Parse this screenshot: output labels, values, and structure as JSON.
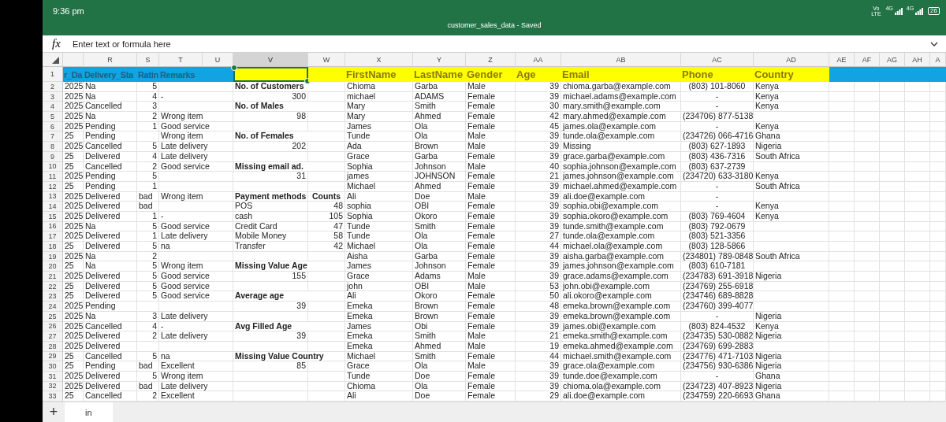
{
  "status_bar": {
    "time": "9:36 pm",
    "carrier": "Vo LTE",
    "networks": [
      "4G",
      "4G"
    ],
    "battery": "26"
  },
  "title_bar": {
    "title": "customer_sales_data - Saved"
  },
  "formula_bar": {
    "label": "fx",
    "placeholder": "Enter text or formula here"
  },
  "sheet": {
    "columns": [
      {
        "selected": false
      },
      {
        "letter": "R",
        "selected": false
      },
      {
        "letter": "S",
        "selected": false
      },
      {
        "letter": "T",
        "selected": false
      },
      {
        "letter": "U",
        "selected": false
      },
      {
        "letter": "V",
        "selected": true
      },
      {
        "letter": "W",
        "selected": false
      },
      {
        "letter": "X",
        "selected": false
      },
      {
        "letter": "Y",
        "selected": false
      },
      {
        "letter": "Z",
        "selected": false
      },
      {
        "letter": "AA",
        "selected": false
      },
      {
        "letter": "AB",
        "selected": false
      },
      {
        "letter": "AC",
        "selected": false
      },
      {
        "letter": "AD",
        "selected": false
      },
      {
        "letter": "AE",
        "selected": false
      },
      {
        "letter": "AF",
        "selected": false
      },
      {
        "letter": "AG",
        "selected": false
      },
      {
        "letter": "AH",
        "selected": false
      },
      {
        "letter": "A",
        "selected": false
      }
    ],
    "header_row": {
      "number": "1",
      "cells": [
        {
          "text": "r_Da",
          "color": "#12a3e3",
          "selected": false
        },
        {
          "text": "Delivery_Sta",
          "color": "#12a3e3",
          "selected": false
        },
        {
          "text": "Ratin",
          "color": "#12a3e3",
          "selected": false
        },
        {
          "text": "Remarks",
          "color": "#12a3e3",
          "selected": false
        },
        {
          "color": "#12a3e3",
          "selected": false
        },
        {
          "color": "#ffff00",
          "selected": true
        },
        {
          "color": "#ffff00",
          "selected": false
        },
        {
          "text": "FirstName",
          "color": "#ffff00",
          "selected": false
        },
        {
          "text": "LastName",
          "color": "#ffff00",
          "selected": false
        },
        {
          "text": "Gender",
          "color": "#ffff00",
          "selected": false
        },
        {
          "text": "Age",
          "color": "#ffff00",
          "selected": false
        },
        {
          "text": "Email",
          "color": "#ffff00",
          "selected": false
        },
        {
          "text": "Phone",
          "color": "#ffff00",
          "selected": false
        },
        {
          "text": "Country",
          "color": "#ffff00",
          "selected": false
        },
        {
          "color": "#12a3e3",
          "selected": false
        },
        {
          "color": "#12a3e3",
          "selected": false
        },
        {
          "color": "#12a3e3",
          "selected": false
        },
        {
          "color": "#12a3e3",
          "selected": false
        },
        {
          "color": "#12a3e3",
          "selected": false
        }
      ]
    },
    "rows": [
      {
        "number": "2",
        "year": "2025",
        "status": "Na",
        "rating": "5",
        "summary": {
          "kind": "heading",
          "text": "No. of Customers"
        },
        "first": "Chioma",
        "last": "Garba",
        "gender": "Male",
        "age": "39",
        "email": "chioma.garba@example.com",
        "phone": "(803) 101-8060",
        "country": "Kenya"
      },
      {
        "number": "3",
        "year": "2025",
        "status": "Na",
        "rating": "4",
        "remarks": "-",
        "summary": {
          "kind": "number",
          "text": "300"
        },
        "first": "michael",
        "last": "ADAMS",
        "gender": "Female",
        "age": "39",
        "email": "michael.adams@example.com",
        "phone": "-",
        "country": "Kenya"
      },
      {
        "number": "4",
        "year": "2025",
        "status": "Cancelled",
        "rating": "3",
        "summary": {
          "kind": "heading",
          "text": "No. of Males"
        },
        "first": "Mary",
        "last": "Smith",
        "gender": "Female",
        "age": "30",
        "email": "mary.smith@example.com",
        "phone": "-",
        "country": "Kenya"
      },
      {
        "number": "5",
        "year": "2025",
        "status": "Na",
        "rating": "2",
        "remarks": "Wrong item",
        "summary": {
          "kind": "number",
          "text": "98"
        },
        "first": "Mary",
        "last": "Ahmed",
        "gender": "Female",
        "age": "42",
        "email": "mary.ahmed@example.com",
        "phone": "(234706) 877-5138"
      },
      {
        "number": "6",
        "year": "2025",
        "status": "Pending",
        "rating": "1",
        "remarks": "Good service",
        "first": "James",
        "last": "Ola",
        "gender": "Female",
        "age": "45",
        "email": "james.ola@example.com",
        "phone": "-",
        "country": "Kenya"
      },
      {
        "number": "7",
        "year": "25",
        "status": "Pending",
        "remarks": "Wrong item",
        "summary": {
          "kind": "heading",
          "text": "No. of Females"
        },
        "first": "Tunde",
        "last": "Ola",
        "gender": "Male",
        "age": "39",
        "email": "tunde.ola@example.com",
        "phone": "(234726) 066-4716",
        "country": "Ghana"
      },
      {
        "number": "8",
        "year": "2025",
        "status": "Cancelled",
        "rating": "5",
        "remarks": "Late delivery",
        "summary": {
          "kind": "number",
          "text": "202"
        },
        "first": "Ada",
        "last": "Brown",
        "gender": "Male",
        "age": "39",
        "email": "Missing",
        "phone": "(803) 627-1893",
        "country": "Nigeria"
      },
      {
        "number": "9",
        "year": "25",
        "status": "Delivered",
        "rating": "4",
        "remarks": "Late delivery",
        "first": "Grace",
        "last": "Garba",
        "gender": "Female",
        "age": "39",
        "email": "grace.garba@example.com",
        "phone": "(803) 436-7316",
        "country": "South Africa"
      },
      {
        "number": "10",
        "year": "25",
        "status": "Cancelled",
        "rating": "2",
        "remarks": "Good service",
        "summary": {
          "kind": "heading",
          "text": "Missing email ad."
        },
        "first": "Sophia",
        "last": "Johnson",
        "gender": "Male",
        "age": "40",
        "email": "sophia.johnson@example.com",
        "phone": "(803) 637-2739"
      },
      {
        "number": "11",
        "year": "2025",
        "status": "Pending",
        "rating": "5",
        "summary": {
          "kind": "number",
          "text": "31"
        },
        "first": "james",
        "last": "JOHNSON",
        "gender": "Female",
        "age": "21",
        "email": "james.johnson@example.com",
        "phone": "(234720) 633-3180",
        "country": "Kenya"
      },
      {
        "number": "12",
        "year": "25",
        "status": "Pending",
        "rating": "1",
        "first": "Michael",
        "last": "Ahmed",
        "gender": "Female",
        "age": "39",
        "email": "michael.ahmed@example.com",
        "phone": "-",
        "country": "South Africa"
      },
      {
        "number": "13",
        "year": "2025",
        "status": "Delivered",
        "rating": "bad",
        "remarks": "Wrong item",
        "summary": {
          "kind": "heading",
          "text": "Payment methods"
        },
        "count": {
          "kind": "heading",
          "text": "Counts"
        },
        "first": "Ali",
        "last": "Doe",
        "gender": "Male",
        "age": "39",
        "email": "ali.doe@example.com",
        "phone": "-"
      },
      {
        "number": "14",
        "year": "2025",
        "status": "Delivered",
        "rating": "bad",
        "summary": {
          "kind": "item",
          "text": "POS"
        },
        "count": {
          "kind": "number",
          "text": "48"
        },
        "first": "sophia",
        "last": "OBI",
        "gender": "Female",
        "age": "39",
        "email": "sophia.obi@example.com",
        "phone": "-",
        "country": "Kenya"
      },
      {
        "number": "15",
        "year": "2025",
        "status": "Delivered",
        "rating": "1",
        "remarks": "-",
        "summary": {
          "kind": "item",
          "text": "cash"
        },
        "count": {
          "kind": "number",
          "text": "105"
        },
        "first": "Sophia",
        "last": "Okoro",
        "gender": "Female",
        "age": "39",
        "email": "sophia.okoro@example.com",
        "phone": "(803) 769-4604",
        "country": "Kenya"
      },
      {
        "number": "16",
        "year": "2025",
        "status": "Na",
        "rating": "5",
        "remarks": "Good service",
        "summary": {
          "kind": "item",
          "text": "Credit Card"
        },
        "count": {
          "kind": "number",
          "text": "47"
        },
        "first": "Tunde",
        "last": "Smith",
        "gender": "Female",
        "age": "39",
        "email": "tunde.smith@example.com",
        "phone": "(803) 792-0679"
      },
      {
        "number": "17",
        "year": "2025",
        "status": "Delivered",
        "rating": "1",
        "remarks": "Late delivery",
        "summary": {
          "kind": "item",
          "text": "Mobile Money"
        },
        "count": {
          "kind": "number",
          "text": "58"
        },
        "first": "Tunde",
        "last": "Ola",
        "gender": "Female",
        "age": "27",
        "email": "tunde.ola@example.com",
        "phone": "(803) 521-3356"
      },
      {
        "number": "18",
        "year": "25",
        "status": "Delivered",
        "rating": "5",
        "remarks": "na",
        "summary": {
          "kind": "item",
          "text": "Transfer"
        },
        "count": {
          "kind": "number",
          "text": "42"
        },
        "first": "Michael",
        "last": "Ola",
        "gender": "Female",
        "age": "44",
        "email": "michael.ola@example.com",
        "phone": "(803) 128-5866"
      },
      {
        "number": "19",
        "year": "2025",
        "status": "Na",
        "rating": "2",
        "first": "Aisha",
        "last": "Garba",
        "gender": "Female",
        "age": "39",
        "email": "aisha.garba@example.com",
        "phone": "(234801) 789-0848",
        "country": "South Africa"
      },
      {
        "number": "20",
        "year": "25",
        "status": "Na",
        "rating": "5",
        "remarks": "Wrong item",
        "summary": {
          "kind": "heading",
          "text": "Missing Value Age"
        },
        "first": "James",
        "last": "Johnson",
        "gender": "Female",
        "age": "39",
        "email": "james.johnson@example.com",
        "phone": "(803) 610-7181"
      },
      {
        "number": "21",
        "year": "2025",
        "status": "Delivered",
        "rating": "5",
        "remarks": "Good service",
        "summary": {
          "kind": "number",
          "text": "155"
        },
        "first": "Grace",
        "last": "Adams",
        "gender": "Male",
        "age": "39",
        "email": "grace.adams@example.com",
        "phone": "(234783) 691-3918",
        "country": "Nigeria"
      },
      {
        "number": "22",
        "year": "25",
        "status": "Delivered",
        "rating": "5",
        "remarks": "Good service",
        "first": "john",
        "last": "OBI",
        "gender": "Male",
        "age": "53",
        "email": "john.obi@example.com",
        "phone": "(234769) 255-6918"
      },
      {
        "number": "23",
        "year": "25",
        "status": "Delivered",
        "rating": "5",
        "remarks": "Good service",
        "summary": {
          "kind": "heading",
          "text": "Average age"
        },
        "first": "Ali",
        "last": "Okoro",
        "gender": "Female",
        "age": "50",
        "email": "ali.okoro@example.com",
        "phone": "(234746) 689-8828"
      },
      {
        "number": "24",
        "year": "2025",
        "status": "Pending",
        "summary": {
          "kind": "number",
          "text": "39"
        },
        "first": "Emeka",
        "last": "Brown",
        "gender": "Female",
        "age": "48",
        "email": "emeka.brown@example.com",
        "phone": "(234760) 399-4077"
      },
      {
        "number": "25",
        "year": "2025",
        "status": "Na",
        "rating": "3",
        "remarks": "Late delivery",
        "first": "Emeka",
        "last": "Brown",
        "gender": "Female",
        "age": "39",
        "email": "emeka.brown@example.com",
        "phone": "-",
        "country": "Nigeria"
      },
      {
        "number": "26",
        "year": "2025",
        "status": "Cancelled",
        "rating": "4",
        "remarks": "-",
        "summary": {
          "kind": "heading",
          "text": "Avg Filled Age"
        },
        "first": "James",
        "last": "Obi",
        "gender": "Female",
        "age": "39",
        "email": "james.obi@example.com",
        "phone": "(803) 824-4532",
        "country": "Kenya"
      },
      {
        "number": "27",
        "year": "2025",
        "status": "Delivered",
        "rating": "2",
        "remarks": "Late delivery",
        "summary": {
          "kind": "number",
          "text": "39"
        },
        "first": "Emeka",
        "last": "Smith",
        "gender": "Male",
        "age": "21",
        "email": "emeka.smith@example.com",
        "phone": "(234735) 530-0882",
        "country": "Nigeria"
      },
      {
        "number": "28",
        "year": "2025",
        "status": "Delivered",
        "first": "Emeka",
        "last": "Ahmed",
        "gender": "Male",
        "age": "19",
        "email": "emeka.ahmed@example.com",
        "phone": "(234769) 699-2883"
      },
      {
        "number": "29",
        "year": "25",
        "status": "Cancelled",
        "rating": "5",
        "remarks": "na",
        "summary": {
          "kind": "heading",
          "text": "Missing Value Country"
        },
        "first": "Michael",
        "last": "Smith",
        "gender": "Female",
        "age": "44",
        "email": "michael.smith@example.com",
        "phone": "(234776) 471-7103",
        "country": "Nigeria"
      },
      {
        "number": "30",
        "year": "25",
        "status": "Pending",
        "rating": "bad",
        "remarks": "Excellent",
        "summary": {
          "kind": "number",
          "text": "85"
        },
        "first": "Grace",
        "last": "Ola",
        "gender": "Male",
        "age": "39",
        "email": "grace.ola@example.com",
        "phone": "(234756) 930-6386",
        "country": "Nigeria"
      },
      {
        "number": "31",
        "year": "2025",
        "status": "Delivered",
        "rating": "5",
        "remarks": "Wrong item",
        "first": "Tunde",
        "last": "Doe",
        "gender": "Female",
        "age": "39",
        "email": "tunde.doe@example.com",
        "phone": "-",
        "country": "Ghana"
      },
      {
        "number": "32",
        "year": "2025",
        "status": "Delivered",
        "rating": "bad",
        "remarks": "Late delivery",
        "first": "Chioma",
        "last": "Ola",
        "gender": "Female",
        "age": "39",
        "email": "chioma.ola@example.com",
        "phone": "(234723) 407-8923",
        "country": "Nigeria"
      },
      {
        "number": "33",
        "year": "25",
        "status": "Cancelled",
        "rating": "2",
        "remarks": "Excellent",
        "first": "Ali",
        "last": "Doe",
        "gender": "Female",
        "age": "29",
        "email": "ali.doe@example.com",
        "phone": "(234759) 220-6693",
        "country": "Ghana"
      }
    ]
  },
  "sheet_tabs": {
    "add_label": "+",
    "tabs": [
      {
        "label": "in",
        "selected": true
      }
    ]
  }
}
